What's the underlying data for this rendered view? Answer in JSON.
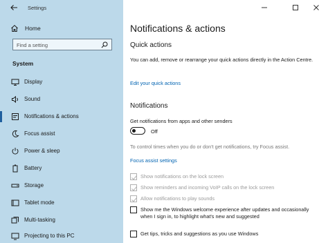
{
  "window": {
    "title": "Settings",
    "controls": [
      "minimize",
      "maximize",
      "close"
    ]
  },
  "sidebar": {
    "home_label": "Home",
    "search": {
      "placeholder": "Find a setting",
      "value": ""
    },
    "section_title": "System",
    "items": [
      {
        "label": "Display",
        "icon": "monitor-icon",
        "active": false
      },
      {
        "label": "Sound",
        "icon": "speaker-icon",
        "active": false
      },
      {
        "label": "Notifications & actions",
        "icon": "notification-icon",
        "active": true
      },
      {
        "label": "Focus assist",
        "icon": "moon-icon",
        "active": false
      },
      {
        "label": "Power & sleep",
        "icon": "power-icon",
        "active": false
      },
      {
        "label": "Battery",
        "icon": "battery-icon",
        "active": false
      },
      {
        "label": "Storage",
        "icon": "storage-icon",
        "active": false
      },
      {
        "label": "Tablet mode",
        "icon": "tablet-icon",
        "active": false
      },
      {
        "label": "Multi-tasking",
        "icon": "multitasking-icon",
        "active": false
      },
      {
        "label": "Projecting to this PC",
        "icon": "project-icon",
        "active": false
      }
    ]
  },
  "main": {
    "title": "Notifications & actions",
    "quick_actions": {
      "heading": "Quick actions",
      "description": "You can add, remove or rearrange your quick actions directly in the Action Centre.",
      "link": "Edit your quick actions"
    },
    "notifications": {
      "heading": "Notifications",
      "toggle_label": "Get notifications from apps and other senders",
      "toggle_state": "Off",
      "focus_text": "To control times when you do or don't get notifications, try Focus assist.",
      "focus_link": "Focus assist settings",
      "options": [
        {
          "label": "Show notifications on the lock screen",
          "checked": true,
          "disabled": true
        },
        {
          "label": "Show reminders and incoming VoIP calls on the lock screen",
          "checked": true,
          "disabled": true
        },
        {
          "label": "Allow notifications to play sounds",
          "checked": true,
          "disabled": true
        },
        {
          "label": "Show me the Windows welcome experience after updates and occasionally when I sign in, to highlight what's new and suggested",
          "checked": false,
          "disabled": false
        },
        {
          "label": "Get tips, tricks and suggestions as you use Windows",
          "checked": false,
          "disabled": false
        }
      ]
    }
  },
  "colors": {
    "sidebar_bg": "#bcd9ea",
    "link": "#0063b1",
    "accent": "#1f5f9e"
  }
}
